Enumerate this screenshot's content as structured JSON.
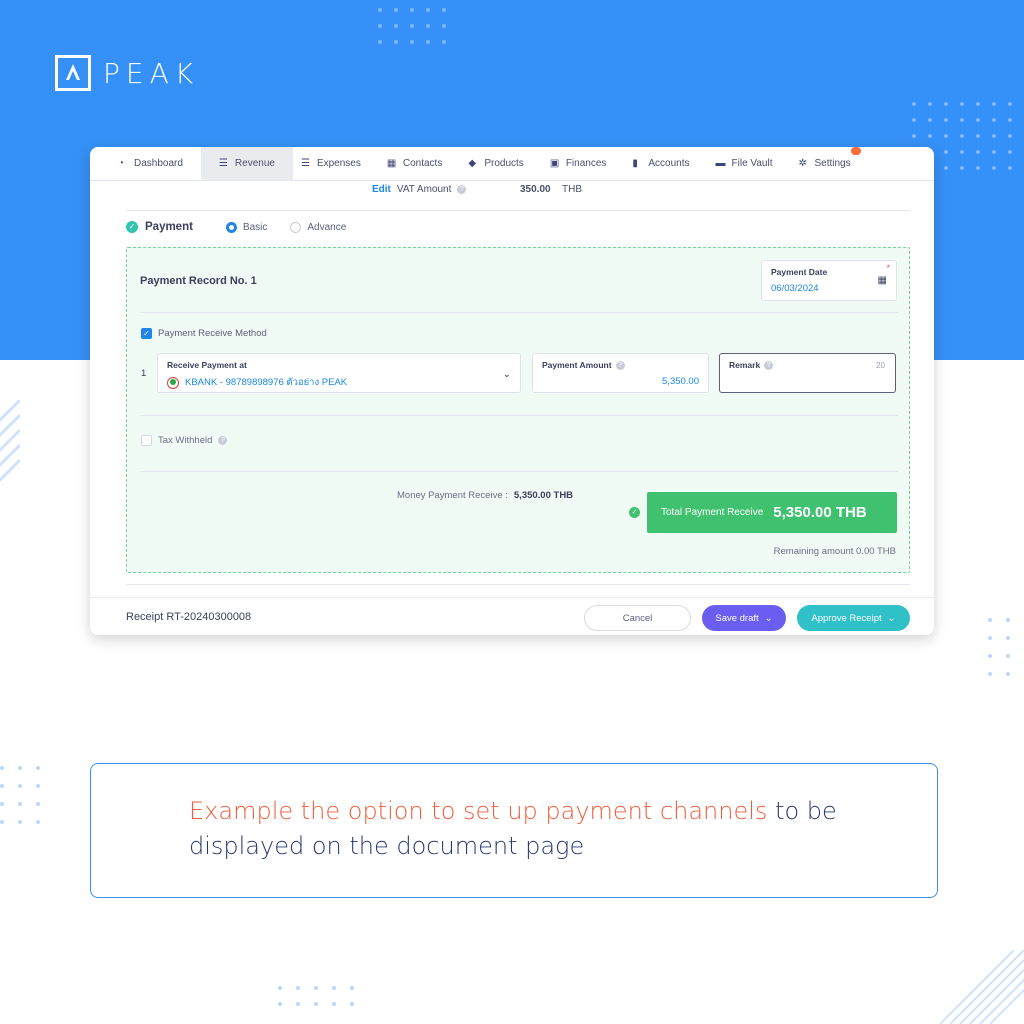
{
  "brand": {
    "logo_text": "PEAK"
  },
  "nav": {
    "items": [
      {
        "label": "Dashboard",
        "icon": "gauge-icon"
      },
      {
        "label": "Revenue",
        "icon": "revenue-icon",
        "active": true
      },
      {
        "label": "Expenses",
        "icon": "expenses-icon"
      },
      {
        "label": "Contacts",
        "icon": "contacts-icon"
      },
      {
        "label": "Products",
        "icon": "box-icon"
      },
      {
        "label": "Finances",
        "icon": "money-icon"
      },
      {
        "label": "Accounts",
        "icon": "ledger-icon"
      },
      {
        "label": "File Vault",
        "icon": "folder-icon"
      },
      {
        "label": "Settings",
        "icon": "gear-icon"
      }
    ]
  },
  "vat": {
    "edit_label": "Edit",
    "label": "VAT Amount",
    "amount": "350.00",
    "currency": "THB"
  },
  "payment": {
    "title": "Payment",
    "mode_basic": "Basic",
    "mode_advance": "Advance",
    "selected_mode": "Basic",
    "record_title": "Payment Record No. 1",
    "date_label": "Payment Date",
    "date_value": "06/03/2024",
    "method_label": "Payment Receive Method",
    "row_number": "1",
    "receive_at_label": "Receive Payment at",
    "receive_at_value": "KBANK - 98789898976 ตัวอย่าง PEAK",
    "amount_label": "Payment Amount",
    "amount_value": "5,350.00",
    "remark_label": "Remark",
    "remark_counter": "20",
    "tax_withheld_label": "Tax Withheld",
    "money_receive_label": "Money Payment Receive :",
    "money_receive_value": "5,350.00 THB",
    "total_label": "Total Payment Receive",
    "total_value": "5,350.00 THB",
    "remaining": "Remaining amount 0.00 THB"
  },
  "footer": {
    "receipt_label": "Receipt RT-20240300008",
    "cancel": "Cancel",
    "save_draft": "Save draft",
    "approve": "Approve Receipt"
  },
  "caption": {
    "highlight": "Example the option to set up payment channels",
    "rest_line1": " to be",
    "line2": "displayed on the document page"
  },
  "colors": {
    "brand_blue": "#3591f7",
    "accent_purple": "#6a5ef0",
    "accent_teal": "#30c1c8",
    "success_green": "#40c16f",
    "highlight_orange": "#ee5d3c"
  }
}
